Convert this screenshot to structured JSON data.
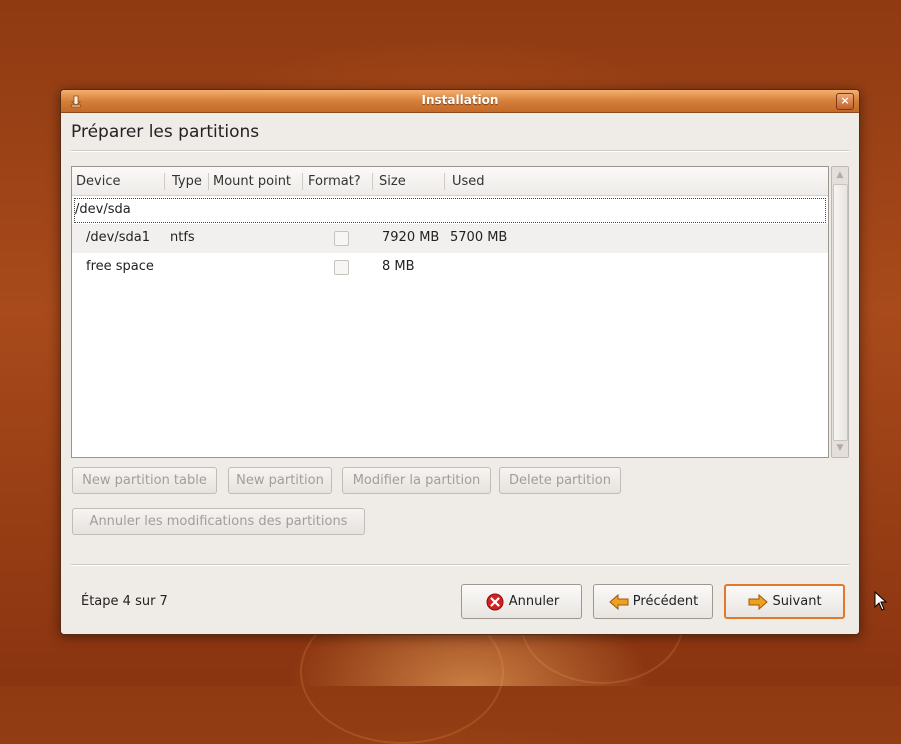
{
  "window": {
    "title": "Installation",
    "close_label": "×"
  },
  "page": {
    "heading": "Préparer les partitions"
  },
  "table": {
    "columns": [
      "Device",
      "Type",
      "Mount point",
      "Format?",
      "Size",
      "Used"
    ],
    "rows": [
      {
        "device": "/dev/sda",
        "type": "",
        "mount": "",
        "size": "",
        "used": ""
      },
      {
        "device": "/dev/sda1",
        "type": "ntfs",
        "mount": "",
        "size": "7920 MB",
        "used": "5700 MB"
      },
      {
        "device": "free space",
        "type": "",
        "mount": "",
        "size": "8 MB",
        "used": ""
      }
    ]
  },
  "actions": {
    "new_table": "New partition table",
    "new_partition": "New partition",
    "edit_partition": "Modifier la partition",
    "delete_partition": "Delete partition",
    "revert": "Annuler les modifications des partitions"
  },
  "footer": {
    "step": "Étape 4 sur 7",
    "cancel": "Annuler",
    "back": "Précédent",
    "forward": "Suivant"
  },
  "icons": {
    "window": "installer-icon",
    "cancel": "cancel-icon",
    "back": "arrow-left-icon",
    "forward": "arrow-right-icon"
  },
  "colors": {
    "titlebar": "#d57f3a",
    "default_button_border": "#e07a2a",
    "cancel_icon": "#d42020",
    "arrow_icon": "#f0a020"
  }
}
